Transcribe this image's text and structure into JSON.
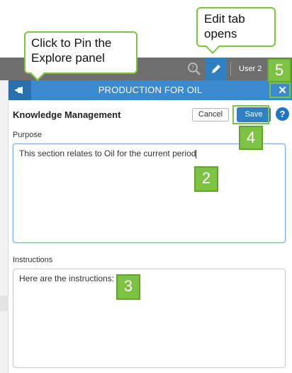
{
  "toolbar": {
    "user_label": "User 2"
  },
  "panel": {
    "title": "PRODUCTION FOR OIL",
    "close_symbol": "✕",
    "heading": "Knowledge Management",
    "cancel_label": "Cancel",
    "save_label": "Save",
    "help_symbol": "?",
    "purpose_label": "Purpose",
    "purpose_value": "This section relates to Oil for the current period",
    "instructions_label": "Instructions",
    "instructions_value": "Here are the instructions:"
  },
  "callouts": {
    "pin": "Click to Pin the Explore panel",
    "edit": "Edit tab opens"
  },
  "badges": [
    "2",
    "3",
    "4",
    "5"
  ],
  "icons": {
    "pin": "pin-icon",
    "search": "search-settings-icon",
    "edit": "pencil-icon",
    "close": "close-icon",
    "help": "help-icon"
  },
  "colors": {
    "toolbar": "#6e6e6e",
    "accent_blue": "#3b8ad0",
    "save_blue": "#2f7fc1",
    "callout_green": "#7dc242"
  }
}
